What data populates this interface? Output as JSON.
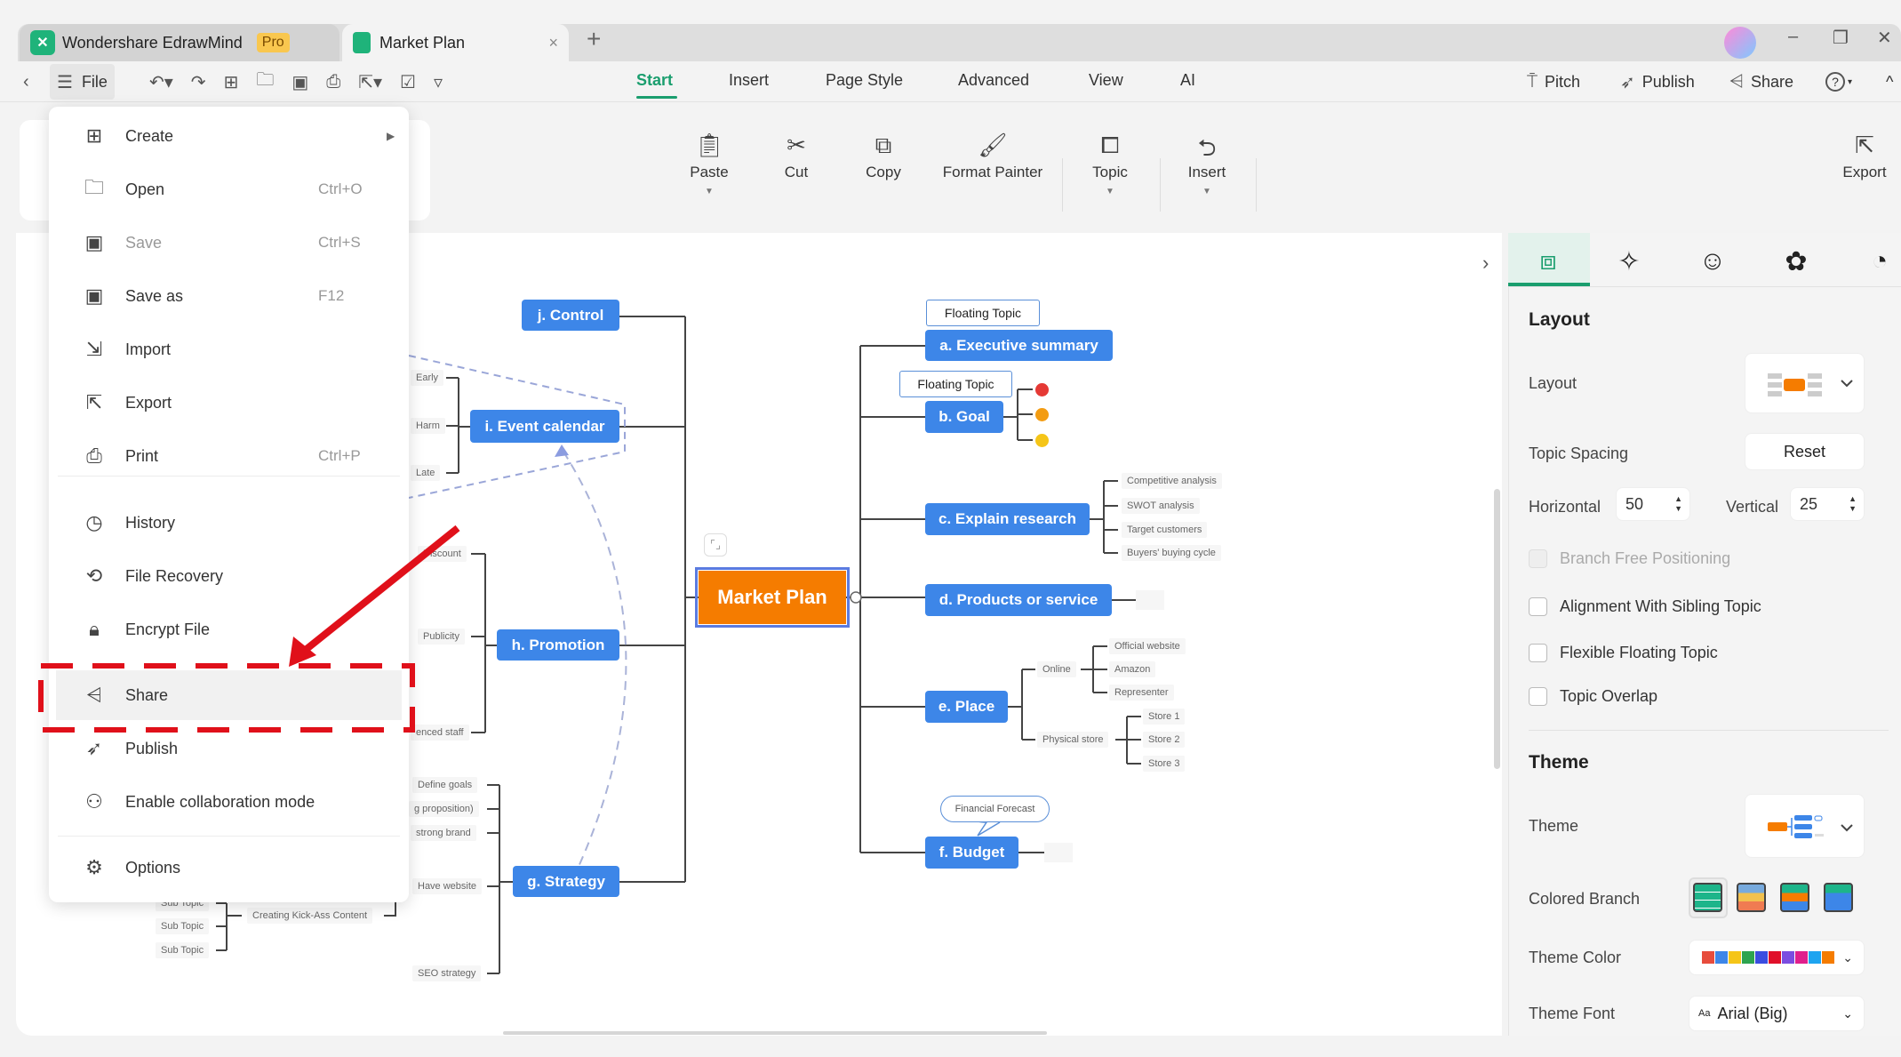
{
  "app": {
    "name": "Wondershare EdrawMind",
    "badge": "Pro",
    "doc_tab": "Market Plan",
    "close": "×",
    "new_tab": "+"
  },
  "window": {
    "minimize": "–",
    "restore": "❐",
    "close": "✕"
  },
  "toolbar": {
    "back": "‹",
    "menu_icon": "☰",
    "file": "File"
  },
  "menu_tabs": [
    "Start",
    "Insert",
    "Page Style",
    "Advanced",
    "View",
    "AI"
  ],
  "right_actions": {
    "pitch": "Pitch",
    "publish": "Publish",
    "share": "Share",
    "help": "?",
    "collapse": "^"
  },
  "ribbon": {
    "paste": "Paste",
    "cut": "Cut",
    "copy": "Copy",
    "format_painter": "Format Painter",
    "topic": "Topic",
    "insert": "Insert",
    "export": "Export"
  },
  "file_menu": {
    "items": [
      {
        "label": "Create",
        "shortcut": "",
        "icon": "create-icon"
      },
      {
        "label": "Open",
        "shortcut": "Ctrl+O",
        "icon": "folder-icon"
      },
      {
        "label": "Save",
        "shortcut": "Ctrl+S",
        "icon": "save-icon",
        "disabled": true
      },
      {
        "label": "Save as",
        "shortcut": "F12",
        "icon": "save-as-icon"
      },
      {
        "label": "Import",
        "shortcut": "",
        "icon": "import-icon"
      },
      {
        "label": "Export",
        "shortcut": "",
        "icon": "export-icon"
      },
      {
        "label": "Print",
        "shortcut": "Ctrl+P",
        "icon": "print-icon"
      },
      {
        "label": "History",
        "shortcut": "",
        "icon": "history-icon"
      },
      {
        "label": "File Recovery",
        "shortcut": "",
        "icon": "file-recovery-icon"
      },
      {
        "label": "Encrypt File",
        "shortcut": "",
        "icon": "encrypt-icon"
      },
      {
        "label": "Share",
        "shortcut": "",
        "icon": "share-icon",
        "highlighted": true
      },
      {
        "label": "Publish",
        "shortcut": "",
        "icon": "publish-icon"
      },
      {
        "label": "Enable collaboration mode",
        "shortcut": "",
        "icon": "collaboration-icon"
      },
      {
        "label": "Options",
        "shortcut": "",
        "icon": "gear-icon"
      }
    ]
  },
  "mindmap": {
    "central": "Market Plan",
    "right": {
      "a": "a. Executive summary",
      "a_float": "Floating Topic",
      "b": "b. Goal",
      "b_float": "Floating Topic",
      "c": "c. Explain research",
      "c_children": [
        "Competitive analysis",
        "SWOT analysis",
        "Target customers",
        "Buyers' buying cycle"
      ],
      "d": "d. Products or service",
      "e": "e. Place",
      "e_online": "Online",
      "e_online_children": [
        "Official website",
        "Amazon",
        "Representer"
      ],
      "e_physical": "Physical store",
      "e_physical_children": [
        "Store 1",
        "Store 2",
        "Store 3"
      ],
      "f": "f. Budget",
      "f_callout": "Financial Forecast"
    },
    "left": {
      "j": "j. Control",
      "i": "i. Event calendar",
      "i_children": [
        "Early",
        "Harm",
        "Late"
      ],
      "h": "h. Promotion",
      "h_children": [
        "Discount",
        "Publicity",
        "enced staff"
      ],
      "g": "g. Strategy",
      "g_children": [
        "Define goals",
        "g proposition)",
        "strong brand",
        "Have website",
        "SEO strategy"
      ],
      "sub_topics": [
        "Sub Topic",
        "Sub Topic",
        "Sub Topic"
      ],
      "creating": "Creating Kick-Ass Content"
    },
    "goal_priority_colors": [
      "#e53935",
      "#f39c12",
      "#f5c518"
    ]
  },
  "panel": {
    "layout_heading": "Layout",
    "layout_label": "Layout",
    "topic_spacing": "Topic Spacing",
    "reset": "Reset",
    "horizontal": "Horizontal",
    "horizontal_value": "50",
    "vertical": "Vertical",
    "vertical_value": "25",
    "checkboxes": [
      {
        "label": "Branch Free Positioning",
        "checked": false,
        "disabled": true
      },
      {
        "label": "Alignment With Sibling Topic",
        "checked": false
      },
      {
        "label": "Flexible Floating Topic",
        "checked": false
      },
      {
        "label": "Topic Overlap",
        "checked": false
      }
    ],
    "theme_heading": "Theme",
    "theme_label": "Theme",
    "colored_branch": "Colored Branch",
    "theme_color": "Theme Color",
    "theme_colors": [
      "#e74c3c",
      "#3d86e8",
      "#f5c518",
      "#2ea44f",
      "#3b4de0",
      "#e0102a",
      "#7b4de0",
      "#e01f8c",
      "#1ea4f0",
      "#f57c00"
    ],
    "theme_font": "Theme Font",
    "theme_font_value": "Arial (Big)",
    "font_prefix": "Aa"
  },
  "colors": {
    "accent": "#1a9e6e",
    "topic": "#3d86e8",
    "central": "#f57c00",
    "annotation": "#e0101a"
  }
}
